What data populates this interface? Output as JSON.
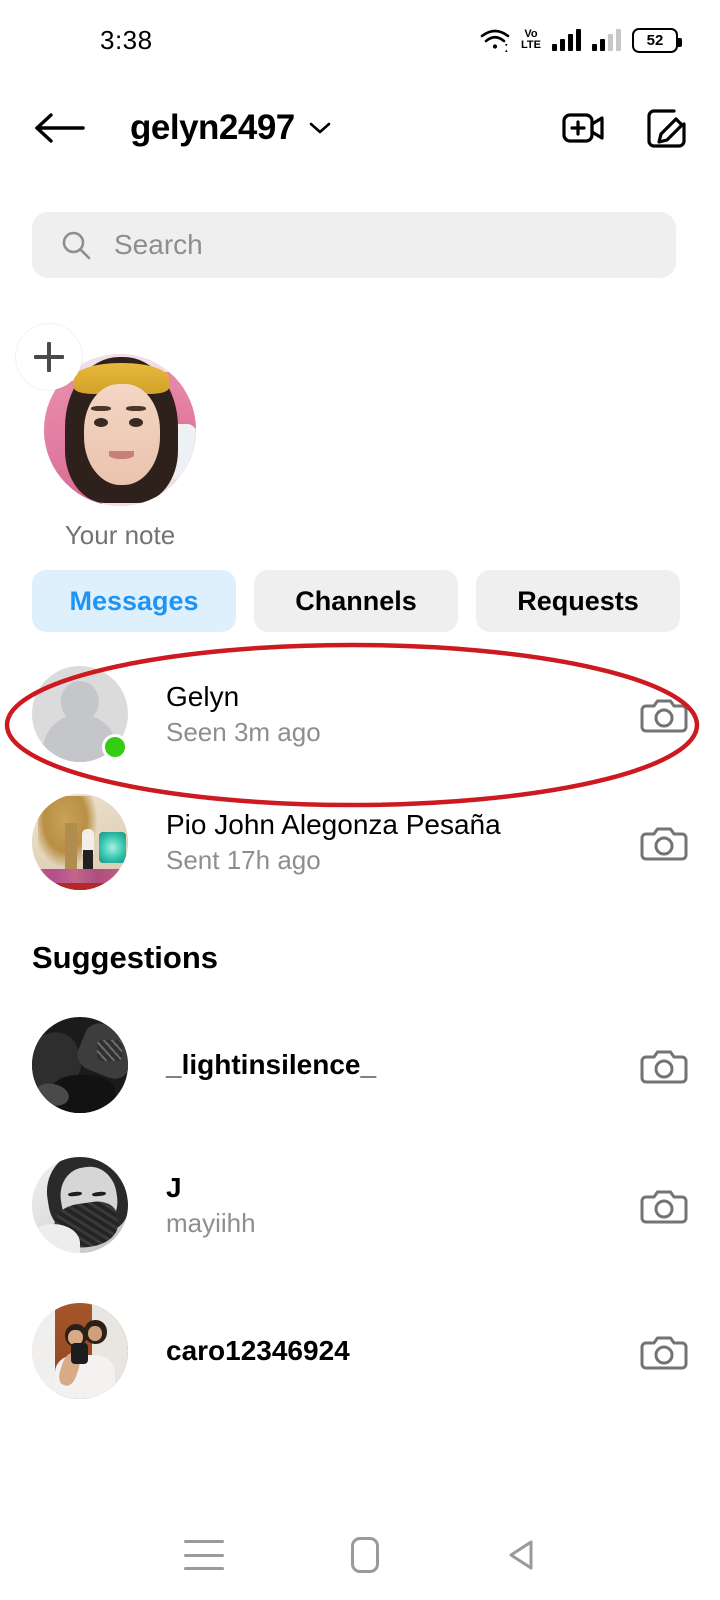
{
  "status_bar": {
    "time": "3:38",
    "wifi_icon": "wifi-icon",
    "network_label": "VoLTE",
    "network_line1": "Vo",
    "network_line2": "LTE",
    "signal_icon_1": "signal-bars-icon",
    "signal_icon_2": "signal-bars-icon",
    "battery_level": "52"
  },
  "header": {
    "back_icon": "back-arrow-icon",
    "title": "gelyn2497",
    "chevron_icon": "chevron-down-icon",
    "video_call_icon": "video-call-plus-icon",
    "compose_icon": "compose-new-message-icon"
  },
  "search": {
    "icon": "search-icon",
    "placeholder": "Search",
    "value": ""
  },
  "note": {
    "add_icon": "plus-icon",
    "avatar_name": "your-note-avatar",
    "label": "Your note"
  },
  "tabs": [
    {
      "label": "Messages",
      "active": true
    },
    {
      "label": "Channels",
      "active": false
    },
    {
      "label": "Requests",
      "active": false
    }
  ],
  "colors": {
    "accent_blue": "#1e95f5",
    "tab_active_bg": "#dff0fd",
    "tab_inactive_bg": "#efefef",
    "search_bg": "#efefef",
    "secondary_text": "#8e8e8e",
    "online_green": "#35cd13",
    "annotation_red": "#cc1a20"
  },
  "conversations": [
    {
      "name": "Gelyn",
      "status": "Seen 3m ago",
      "online": true,
      "avatar": "placeholder-person-avatar",
      "camera_icon": "camera-icon",
      "highlighted": true
    },
    {
      "name": "Pio John Alegonza Pesaña",
      "status": "Sent 17h ago",
      "online": false,
      "avatar": "pio-john-avatar",
      "camera_icon": "camera-icon",
      "highlighted": false
    }
  ],
  "suggestions_section": {
    "title": "Suggestions",
    "items": [
      {
        "name": "_lightinsilence_",
        "status": "",
        "avatar": "lightinsilence-avatar",
        "camera_icon": "camera-icon"
      },
      {
        "name": "J",
        "status": "mayiihh",
        "avatar": "j-mayiihh-avatar",
        "camera_icon": "camera-icon"
      },
      {
        "name": "caro12346924",
        "status": "",
        "avatar": "caro12346924-avatar",
        "camera_icon": "camera-icon"
      }
    ]
  },
  "annotation": {
    "type": "ellipse",
    "target": "Gelyn",
    "color": "#cc1a20"
  },
  "nav_bar": {
    "recents_icon": "recents-menu-icon",
    "home_icon": "home-icon",
    "back_icon": "back-triangle-icon"
  }
}
